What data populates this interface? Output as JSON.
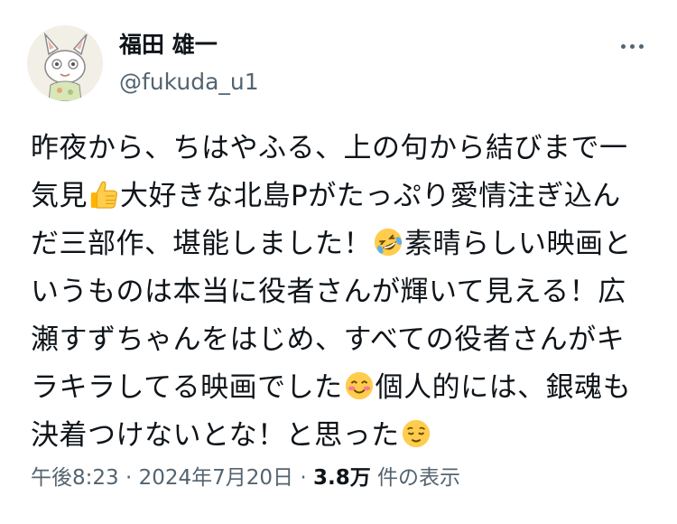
{
  "user": {
    "display_name": "福田 雄一",
    "handle": "@fukuda_u1"
  },
  "tweet": {
    "lines": [
      [
        {
          "t": "昨夜から、ちはやふる、上の句から結びまで一"
        }
      ],
      [
        {
          "t": "気見"
        },
        {
          "e": "thumbs-up-emoji"
        },
        {
          "t": "大好きな北島Pがたっぷり愛情注ぎ込ん"
        }
      ],
      [
        {
          "t": "だ三部作、堪能しました！"
        },
        {
          "e": "rolling-laughing-emoji"
        },
        {
          "t": "素晴らしい映画と"
        }
      ],
      [
        {
          "t": "いうものは本当に役者さんが輝いて見える！広"
        }
      ],
      [
        {
          "t": "瀬すずちゃんをはじめ、すべての役者さんがキ"
        }
      ],
      [
        {
          "t": "ラキラしてる映画でした"
        },
        {
          "e": "smiling-blush-emoji"
        },
        {
          "t": "個人的には、銀魂も"
        }
      ],
      [
        {
          "t": "決着つけないとな！と思った"
        },
        {
          "e": "relieved-face-emoji"
        }
      ]
    ]
  },
  "meta": {
    "time": "午後8:23",
    "sep1": " · ",
    "date": "2024年7月20日",
    "sep2": " · ",
    "views_count": "3.8万",
    "views_label": " 件の表示"
  },
  "colors": {
    "text_primary": "#0f1419",
    "text_secondary": "#536471",
    "emoji_yellow": "#ffcc4d"
  }
}
